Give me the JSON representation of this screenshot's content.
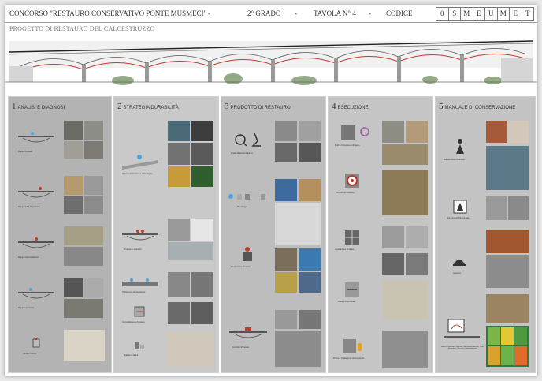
{
  "header": {
    "title": "CONCORSO \"RESTAURO CONSERVATIVO PONTE  MUSMECI\"",
    "sep1": "-",
    "grade": "2° GRADO",
    "sep2": "-",
    "sheet": "TAVOLA N° 4",
    "sep3": "-",
    "code_label": "CODICE",
    "code": [
      "0",
      "S",
      "M",
      "E",
      "U",
      "M",
      "E",
      "T"
    ]
  },
  "subtitle": "PROGETTO DI RESTAURO DEL CALCESTRUZZO",
  "panels": [
    {
      "num": "1",
      "title": "ANALISI E DIAGNOSI",
      "bg": "#b3b3b3",
      "captions": [
        "Mappa Degrado",
        "Mappa Stato Superficiale",
        "Mappa Carbonatazione",
        "Mappatura Cloruri",
        "Carote Provino"
      ]
    },
    {
      "num": "2",
      "title": "STRATEGIA DURABILITÀ",
      "bg": "#c9c9c9",
      "captions": [
        "Impermeabilizzazione e Drenaggio",
        "Protezione Catodica",
        "Trattamento Idrorepellente",
        "Consolidamento Armature",
        "Sigillatura Giunti"
      ]
    },
    {
      "num": "3",
      "title": "PRODOTTO DI RESTAURO",
      "bg": "#bdbdbd",
      "captions": [
        "Analisi Materiali Originali",
        "Mix Design",
        "Preparazione Prodotto",
        "Controllo Materiale"
      ]
    },
    {
      "num": "4",
      "title": "ESECUZIONE",
      "bg": "#c5c5c5",
      "captions": [
        "Pulizia Completa a Idrogetto",
        "Protezione Catodica",
        "Applicazione Prodotto",
        "Finitura Superficiale",
        "Pulizia e Trattamento Idrorepellente"
      ]
    },
    {
      "num": "5",
      "title": "MANUALE DI CONSERVAZIONE",
      "bg": "#c4c4c4",
      "captions": [
        "Manutenzione Ordinaria",
        "Monitoraggio Strumentale",
        "Ispezioni",
        "Analisi Evoluzione Degrado, Rilevamenti Annuali, Ciclo Stagionale, Pressioni Carbonatazione"
      ]
    }
  ],
  "colors": {
    "accent_red": "#c0392b",
    "panel_dark": "#9a9a9a"
  }
}
